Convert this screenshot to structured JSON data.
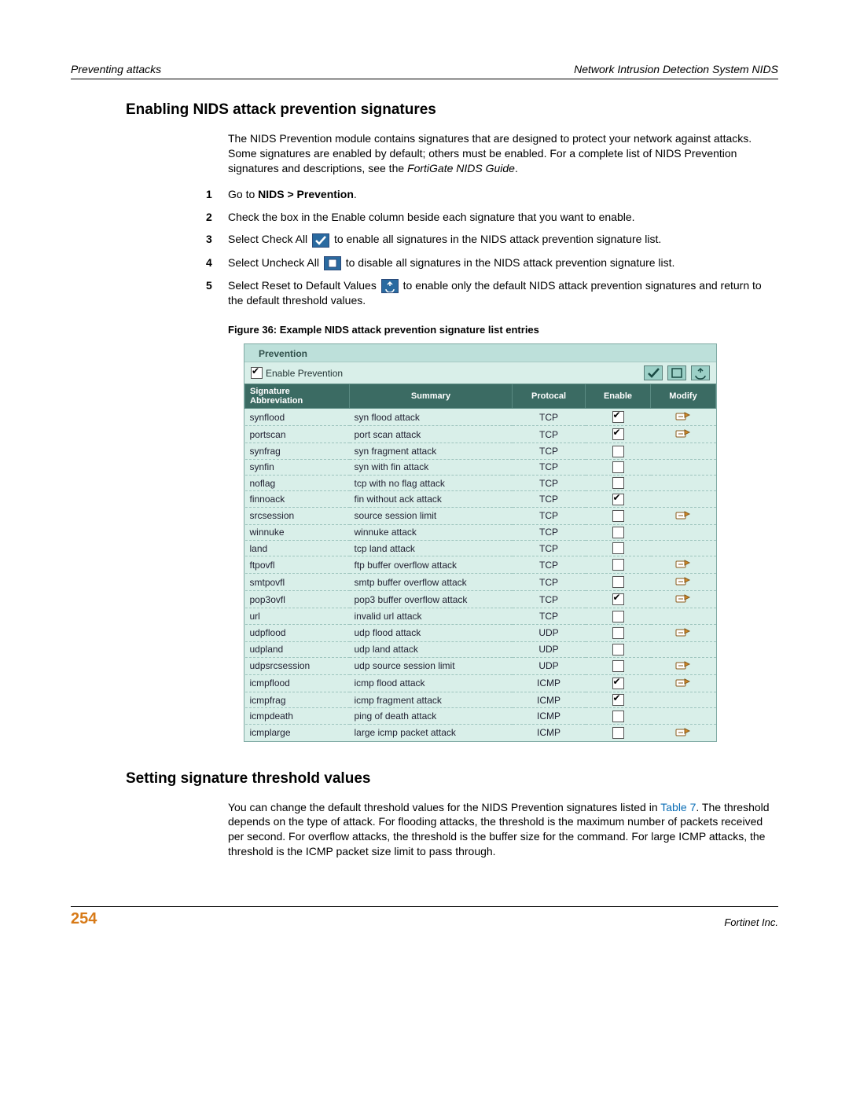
{
  "header": {
    "left": "Preventing attacks",
    "right": "Network Intrusion Detection System NIDS"
  },
  "section1": {
    "title": "Enabling NIDS attack prevention signatures",
    "para": "The NIDS Prevention module contains signatures that are designed to protect your network against attacks. Some signatures are enabled by default; others must be enabled. For a complete list of NIDS Prevention signatures and descriptions, see the ",
    "para_em": "FortiGate NIDS Guide",
    "para_end": ".",
    "steps": {
      "s1a": "Go to ",
      "s1b": "NIDS > Prevention",
      "s1c": ".",
      "s2": "Check the box in the Enable column beside each signature that you want to enable.",
      "s3a": "Select Check All ",
      "s3b": " to enable all signatures in the NIDS attack prevention signature list.",
      "s4a": "Select Uncheck All ",
      "s4b": " to disable all signatures in the NIDS attack prevention signature list.",
      "s5a": "Select Reset to Default Values ",
      "s5b": " to enable only the default NIDS attack prevention signatures and return to the default threshold values."
    },
    "figure_caption": "Figure 36: Example NIDS attack prevention signature list entries"
  },
  "ui": {
    "tab": "Prevention",
    "enable_label": "Enable Prevention",
    "headers": {
      "sig": "Signature Abbreviation",
      "sum": "Summary",
      "proto": "Protocal",
      "en": "Enable",
      "mod": "Modify"
    },
    "rows": [
      {
        "sig": "synflood",
        "sum": "syn flood attack",
        "proto": "TCP",
        "en": true,
        "mod": true
      },
      {
        "sig": "portscan",
        "sum": "port scan attack",
        "proto": "TCP",
        "en": true,
        "mod": true
      },
      {
        "sig": "synfrag",
        "sum": "syn fragment attack",
        "proto": "TCP",
        "en": false,
        "mod": false
      },
      {
        "sig": "synfin",
        "sum": "syn with fin attack",
        "proto": "TCP",
        "en": false,
        "mod": false
      },
      {
        "sig": "noflag",
        "sum": "tcp with no flag attack",
        "proto": "TCP",
        "en": false,
        "mod": false
      },
      {
        "sig": "finnoack",
        "sum": "fin without ack attack",
        "proto": "TCP",
        "en": true,
        "mod": false
      },
      {
        "sig": "srcsession",
        "sum": "source session limit",
        "proto": "TCP",
        "en": false,
        "mod": true
      },
      {
        "sig": "winnuke",
        "sum": "winnuke attack",
        "proto": "TCP",
        "en": false,
        "mod": false
      },
      {
        "sig": "land",
        "sum": "tcp land attack",
        "proto": "TCP",
        "en": false,
        "mod": false
      },
      {
        "sig": "ftpovfl",
        "sum": "ftp buffer overflow attack",
        "proto": "TCP",
        "en": false,
        "mod": true
      },
      {
        "sig": "smtpovfl",
        "sum": "smtp buffer overflow attack",
        "proto": "TCP",
        "en": false,
        "mod": true
      },
      {
        "sig": "pop3ovfl",
        "sum": "pop3 buffer overflow attack",
        "proto": "TCP",
        "en": true,
        "mod": true
      },
      {
        "sig": "url",
        "sum": "invalid url attack",
        "proto": "TCP",
        "en": false,
        "mod": false
      },
      {
        "sig": "udpflood",
        "sum": "udp flood attack",
        "proto": "UDP",
        "en": false,
        "mod": true
      },
      {
        "sig": "udpland",
        "sum": "udp land attack",
        "proto": "UDP",
        "en": false,
        "mod": false
      },
      {
        "sig": "udpsrcsession",
        "sum": "udp source session limit",
        "proto": "UDP",
        "en": false,
        "mod": true
      },
      {
        "sig": "icmpflood",
        "sum": "icmp flood attack",
        "proto": "ICMP",
        "en": true,
        "mod": true
      },
      {
        "sig": "icmpfrag",
        "sum": "icmp fragment attack",
        "proto": "ICMP",
        "en": true,
        "mod": false
      },
      {
        "sig": "icmpdeath",
        "sum": "ping of death attack",
        "proto": "ICMP",
        "en": false,
        "mod": false
      },
      {
        "sig": "icmplarge",
        "sum": "large icmp packet attack",
        "proto": "ICMP",
        "en": false,
        "mod": true
      }
    ]
  },
  "section2": {
    "title": "Setting signature threshold values",
    "para_a": "You can change the default threshold values for the NIDS Prevention signatures listed in ",
    "link": "Table 7",
    "para_b": ". The threshold depends on the type of attack. For flooding attacks, the threshold is the maximum number of packets received per second. For overflow attacks, the threshold is the buffer size for the command. For large ICMP attacks, the threshold is the ICMP packet size limit to pass through."
  },
  "footer": {
    "page": "254",
    "company": "Fortinet Inc."
  }
}
